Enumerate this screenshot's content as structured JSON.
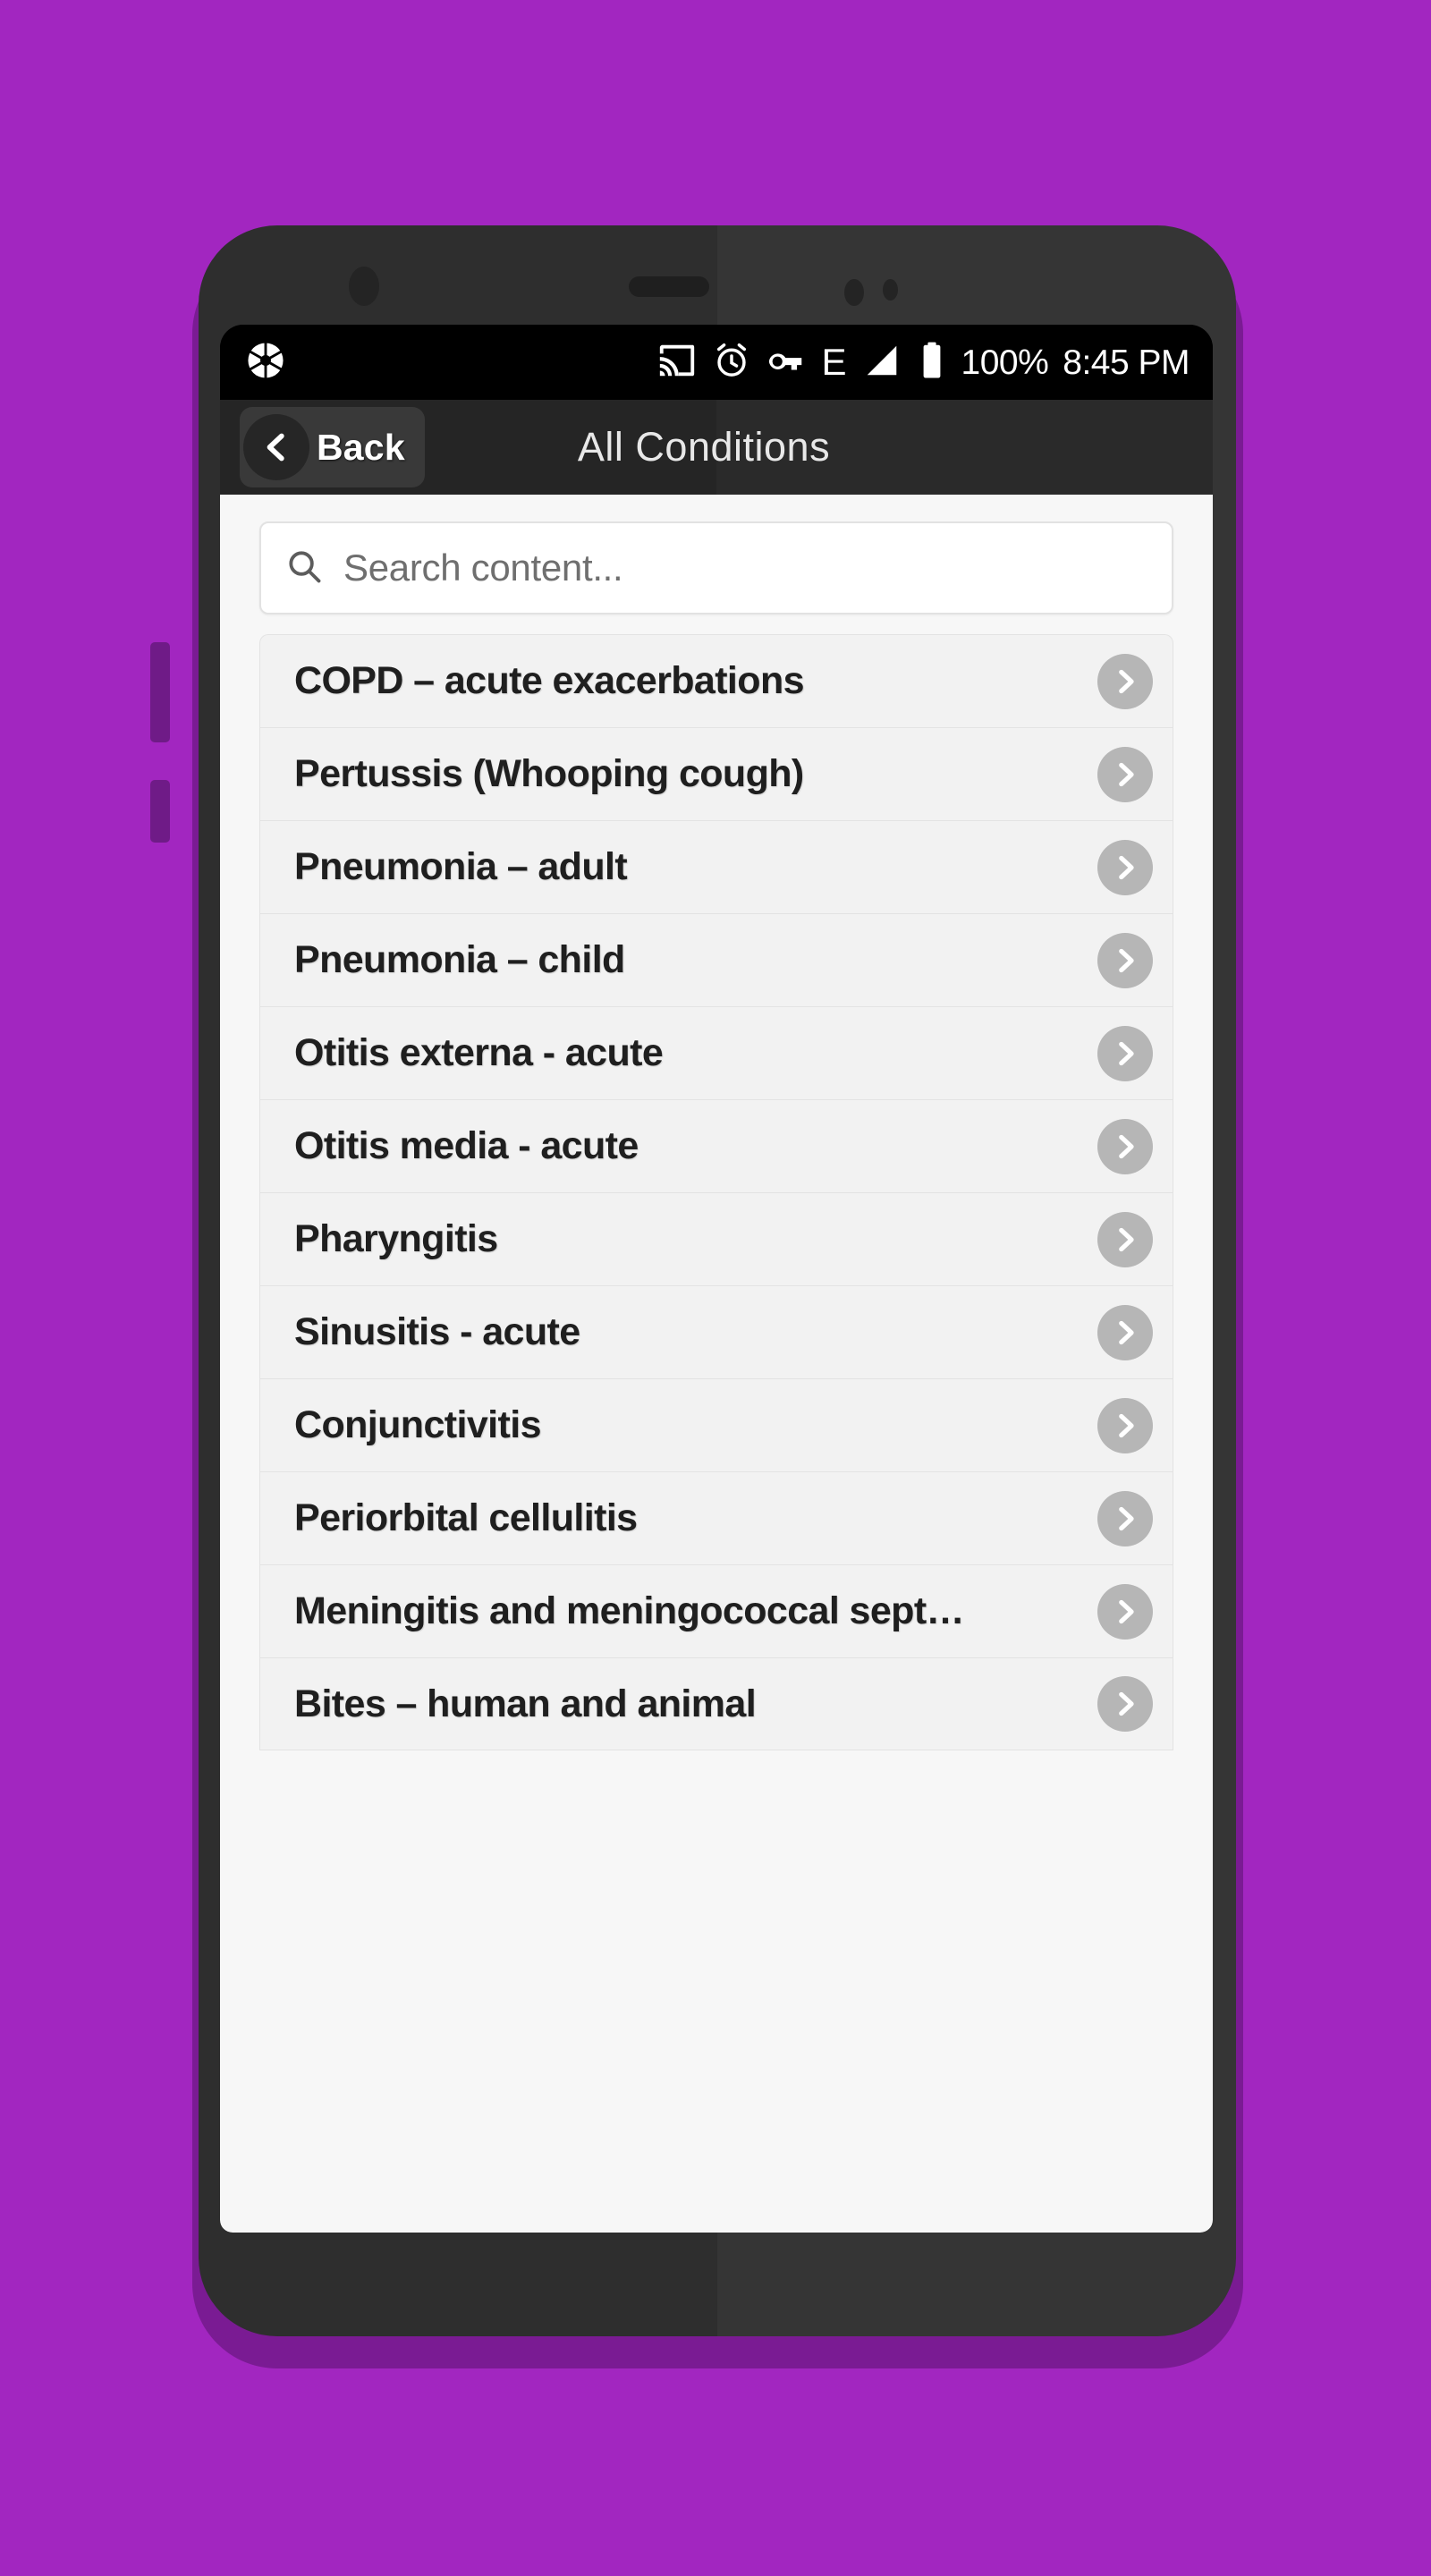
{
  "theme": {
    "background_purple": "#a226c0",
    "phone_body": "#2e2e2e",
    "statusbar_bg": "#000000",
    "titlebar_bg": "#252525",
    "content_bg": "#f7f7f7",
    "row_bg": "#f2f2f2",
    "chevron_circle": "#b6b6b6"
  },
  "statusbar": {
    "app_icon": "camera-aperture-icon",
    "icons": [
      "cast-icon",
      "alarm-clock-icon",
      "vpn-key-icon"
    ],
    "network_type": "E",
    "signal_icon": "signal-bars-icon",
    "battery_icon": "battery-full-icon",
    "battery_level": "100%",
    "clock": "8:45 PM"
  },
  "titlebar": {
    "back_label": "Back",
    "back_icon": "chevron-left-icon",
    "title": "All Conditions"
  },
  "search": {
    "icon": "search-icon",
    "placeholder": "Search content...",
    "value": ""
  },
  "list": {
    "row_icon": "chevron-right-icon",
    "items": [
      {
        "label": "COPD – acute exacerbations"
      },
      {
        "label": "Pertussis (Whooping cough)"
      },
      {
        "label": "Pneumonia – adult"
      },
      {
        "label": "Pneumonia – child"
      },
      {
        "label": "Otitis externa - acute"
      },
      {
        "label": "Otitis media - acute"
      },
      {
        "label": "Pharyngitis"
      },
      {
        "label": "Sinusitis - acute"
      },
      {
        "label": "Conjunctivitis"
      },
      {
        "label": "Periorbital cellulitis"
      },
      {
        "label": "Meningitis and meningococcal sept…"
      },
      {
        "label": "Bites – human and animal"
      }
    ]
  }
}
